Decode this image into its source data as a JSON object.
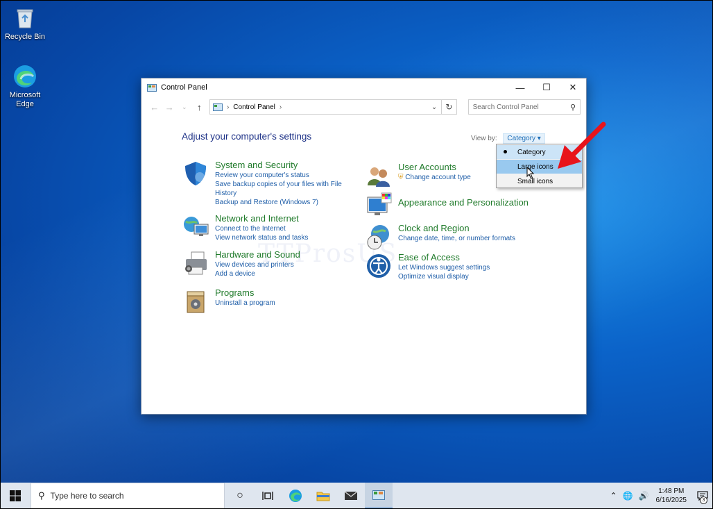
{
  "desktop": {
    "icons": [
      {
        "label": "Recycle Bin",
        "icon": "recycle-bin-icon"
      },
      {
        "label": "Microsoft Edge",
        "icon": "edge-icon"
      }
    ]
  },
  "window": {
    "title": "Control Panel",
    "address": {
      "breadcrumb": "Control Panel"
    },
    "search": {
      "placeholder": "Search Control Panel"
    },
    "heading": "Adjust your computer's settings",
    "view_by": {
      "label": "View by:",
      "value": "Category"
    },
    "watermark": "TTProsUS",
    "items": {
      "system": {
        "title": "System and Security",
        "links": [
          "Review your computer's status",
          "Save backup copies of your files with File History",
          "Backup and Restore (Windows 7)"
        ]
      },
      "network": {
        "title": "Network and Internet",
        "links": [
          "Connect to the Internet",
          "View network status and tasks"
        ]
      },
      "hardware": {
        "title": "Hardware and Sound",
        "links": [
          "View devices and printers",
          "Add a device"
        ]
      },
      "programs": {
        "title": "Programs",
        "links": [
          "Uninstall a program"
        ]
      },
      "users": {
        "title": "User Accounts",
        "links": [
          "Change account type"
        ]
      },
      "appearance": {
        "title": "Appearance and Personalization",
        "links": []
      },
      "clock": {
        "title": "Clock and Region",
        "links": [
          "Change date, time, or number formats"
        ]
      },
      "ease": {
        "title": "Ease of Access",
        "links": [
          "Let Windows suggest settings",
          "Optimize visual display"
        ]
      }
    }
  },
  "dropdown": {
    "options": [
      "Category",
      "Large icons",
      "Small icons"
    ],
    "selected": "Category",
    "hovered": "Large icons"
  },
  "taskbar": {
    "search_placeholder": "Type here to search",
    "time": "1:48 PM",
    "date": "6/16/2025",
    "notification_count": "3"
  },
  "colors": {
    "accent": "#1f7a2a",
    "link": "#1f5ea8",
    "arrow": "#e8141b"
  }
}
